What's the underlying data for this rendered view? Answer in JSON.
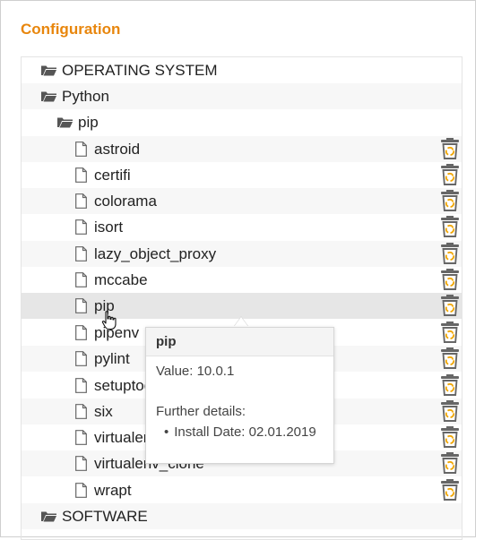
{
  "panel": {
    "title": "Configuration"
  },
  "tree": {
    "root_os": "OPERATING SYSTEM",
    "root_python": "Python",
    "folder_pip": "pip",
    "packages": [
      "astroid",
      "certifi",
      "colorama",
      "isort",
      "lazy_object_proxy",
      "mccabe",
      "pip",
      "pipenv",
      "pylint",
      "setuptools",
      "six",
      "virtualenv",
      "virtualenv_clone",
      "wrapt"
    ],
    "root_software": "SOFTWARE"
  },
  "tooltip": {
    "title": "pip",
    "value_line": "Value: 10.0.1",
    "details_label": "Further details:",
    "details": [
      "Install Date: 02.01.2019"
    ]
  },
  "colors": {
    "accent": "#e8860c",
    "trash_icon": "#666666",
    "recycle_symbol": "#f0a500"
  },
  "icons": {
    "folder": "folder-open-icon",
    "file": "file-icon",
    "delete": "trash-icon",
    "cursor": "hand-pointer-icon"
  }
}
